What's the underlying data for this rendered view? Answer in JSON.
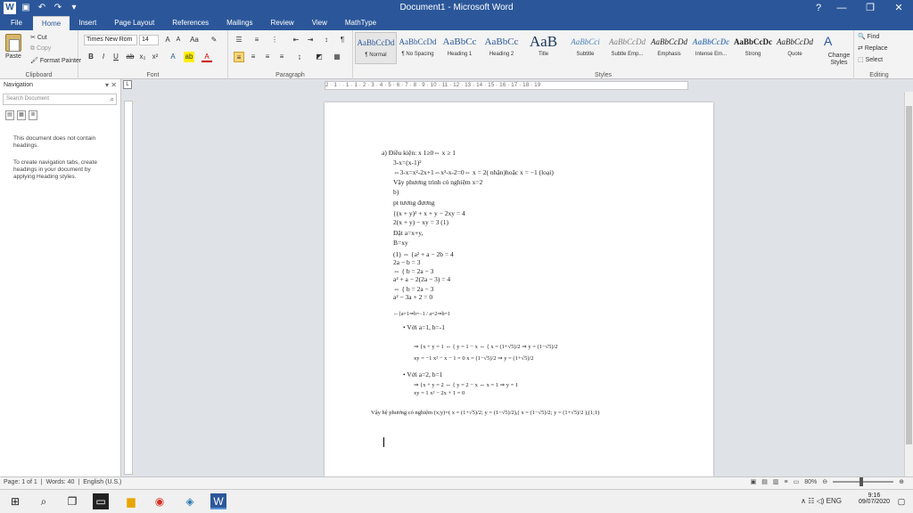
{
  "app": {
    "title": "Document1 - Microsoft Word",
    "word_logo": "W",
    "help": "?",
    "minimize": "—",
    "restore": "❐",
    "close": "✕"
  },
  "tabs": [
    "File",
    "Home",
    "Insert",
    "Page Layout",
    "References",
    "Mailings",
    "Review",
    "View",
    "MathType"
  ],
  "ribbon": {
    "clipboard": {
      "label": "Clipboard",
      "paste": "Paste",
      "cut": "Cut",
      "copy": "Copy",
      "format_painter": "Format Painter"
    },
    "font": {
      "label": "Font",
      "font_name": "Times New Rom",
      "font_size": "14"
    },
    "paragraph": {
      "label": "Paragraph"
    },
    "styles": {
      "label": "Styles",
      "items": [
        {
          "preview": "AaBbCcDd",
          "name": "¶ Normal"
        },
        {
          "preview": "AaBbCcDd",
          "name": "¶ No Spacing"
        },
        {
          "preview": "AaBbCc",
          "name": "Heading 1"
        },
        {
          "preview": "AaBbCc",
          "name": "Heading 2"
        },
        {
          "preview": "AaB",
          "name": "Title"
        },
        {
          "preview": "AaBbCci",
          "name": "Subtitle"
        },
        {
          "preview": "AaBbCcDd",
          "name": "Subtle Emp..."
        },
        {
          "preview": "AaBbCcDd",
          "name": "Emphasis"
        },
        {
          "preview": "AaBbCcDc",
          "name": "Intense Em..."
        },
        {
          "preview": "AaBbCcDc",
          "name": "Strong"
        },
        {
          "preview": "AaBbCcDd",
          "name": "Quote"
        }
      ],
      "change_styles": "Change Styles"
    },
    "editing": {
      "label": "Editing",
      "find": "Find",
      "replace": "Replace",
      "select": "Select"
    }
  },
  "ruler": {
    "ticks": "2 · 1 · · 1 · 1 · 2 · 3 · 4 · 5 · 6 · 7 · 8 · 9 · 10 · 11 · 12 · 13 · 14 · 15 · 16 · 17 · 18 · 19"
  },
  "navigation": {
    "title": "Navigation",
    "search_placeholder": "Search Document",
    "msg1": "This document does not contain headings.",
    "msg2": "To create navigation tabs, create headings in your document by applying Heading styles."
  },
  "document": {
    "lines": [
      "a)   Điều kiện: x 1≥0⇔ x ≥ 1",
      "3-x=(x-1)²",
      "⇔3-x=x²-2x+1⇔x²-x-2=0⇔ x = 2( nhận)hoặc x = −1 (loại)",
      "Vậy phương trình có nghiệm x=2",
      "b)",
      "pt tương đương",
      "{(x + y)² + x + y − 2xy = 4",
      " 2(x + y) − xy = 3          (1)",
      "Đặt a=x+y,",
      "B=xy",
      "(1) ⇔ {a² + a − 2b = 4",
      "        2a − b = 3",
      "     ⇔ {   b = 2a − 3",
      "        a² + a − 2(2a − 3) = 4",
      "     ⇔ {  b = 2a − 3",
      "        a² − 3a + 2 = 0",
      "     ⇔{a=1⇒b=−1 / a=2⇒b=1",
      "•   Với a=1, b=-1",
      "⇒ {x + y = 1     ⇔ {  y = 1 − x         ⇔ { x = (1+√5)/2 ⇒ y = (1−√5)/2",
      "    xy = −1          x² − x − 1 = 0          x = (1−√5)/2 ⇒ y = (1+√5)/2",
      "•   Với a=2, b=1",
      "⇒ {x + y = 2   ⇔ {  y = 2 − x       ⇔ x = 1 ⇒ y = 1",
      "    xy = 1          x² − 2x + 1 = 0",
      "Vậy hệ phương có nghiệm (x;y)=( x = (1+√5)/2; y = (1−√5)/2),( x = (1−√5)/2; y = (1+√5)/2 ),(1;1)"
    ]
  },
  "status": {
    "page": "Page: 1 of 1",
    "words": "Words: 40",
    "lang": "English (U.S.)",
    "zoom": "80%"
  },
  "taskbar": {
    "time": "9:16",
    "date": "09/07/2020",
    "lang": "ENG"
  }
}
